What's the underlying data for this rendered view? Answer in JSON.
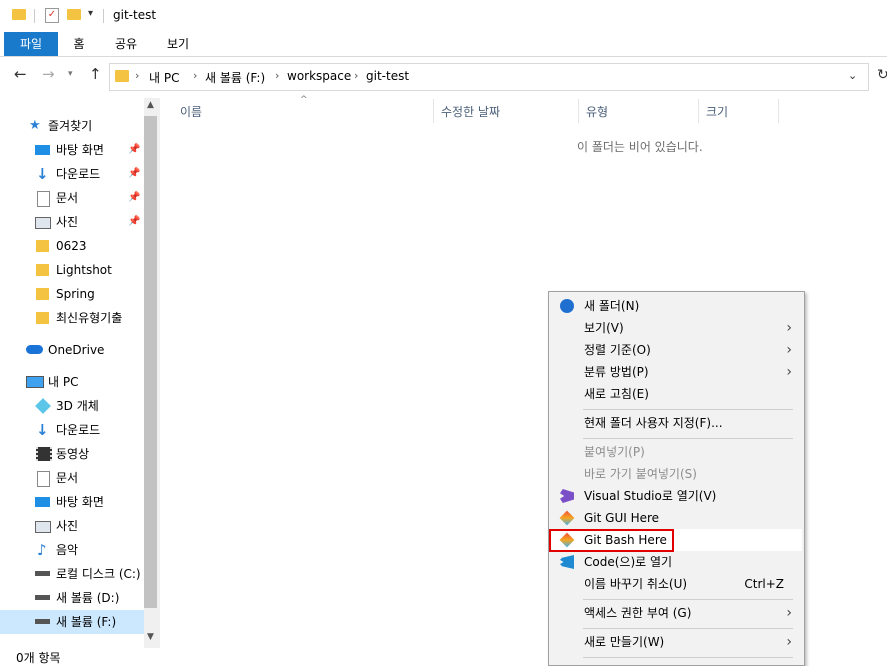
{
  "window": {
    "title": "git-test"
  },
  "ribbon": {
    "tabs": [
      "파일",
      "홈",
      "공유",
      "보기"
    ]
  },
  "address": {
    "crumbs": [
      "내 PC",
      "새 볼륨 (F:)",
      "workspace",
      "git-test"
    ]
  },
  "columns": [
    "이름",
    "수정한 날짜",
    "유형",
    "크기"
  ],
  "content": {
    "empty_text": "이 폴더는 비어 있습니다."
  },
  "nav": {
    "quick_access": "즐겨찾기",
    "quick_items": [
      "바탕 화면",
      "다운로드",
      "문서",
      "사진",
      "0623",
      "Lightshot",
      "Spring",
      "최신유형기출"
    ],
    "onedrive": "OneDrive",
    "this_pc": "내 PC",
    "pc_items": [
      "3D 개체",
      "다운로드",
      "동영상",
      "문서",
      "바탕 화면",
      "사진",
      "음악",
      "로컬 디스크 (C:)",
      "새 볼륨 (D:)",
      "새 볼륨 (F:)"
    ]
  },
  "status": {
    "count": "0개 항목"
  },
  "context_menu": {
    "new_folder": "새 폴더(N)",
    "view": "보기(V)",
    "sort": "정렬 기준(O)",
    "group": "분류 방법(P)",
    "refresh": "새로 고침(E)",
    "customize": "현재 폴더 사용자 지정(F)...",
    "paste": "붙여넣기(P)",
    "paste_shortcut": "바로 가기 붙여넣기(S)",
    "visual_studio": "Visual Studio로 열기(V)",
    "git_gui": "Git GUI Here",
    "git_bash": "Git Bash Here",
    "code": "Code(으)로 열기",
    "undo": "이름 바꾸기 취소(U)",
    "undo_shortcut": "Ctrl+Z",
    "access": "액세스 권한 부여 (G)",
    "new": "새로 만들기(W)"
  },
  "colors": {
    "accent": "#1979ca",
    "highlight": "#e00000",
    "selected": "#cce8ff"
  }
}
